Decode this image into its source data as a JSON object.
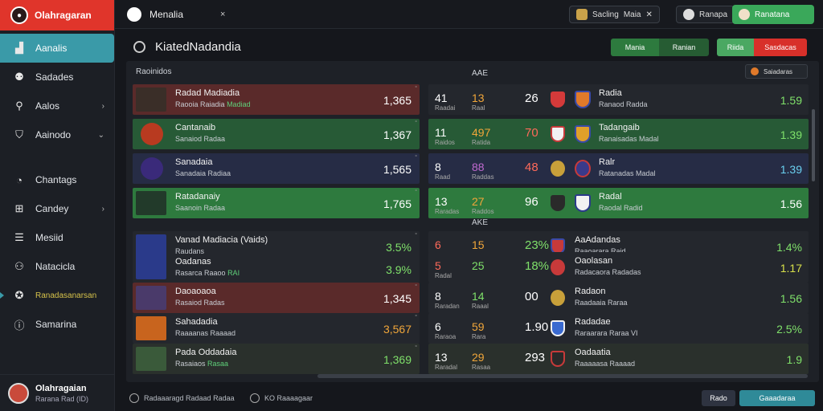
{
  "brand": {
    "name": "Olahragaran"
  },
  "sidebar": {
    "items": [
      {
        "label": "Aanalis",
        "icon": "chart-icon"
      },
      {
        "label": "Sadades",
        "icon": "users-icon"
      },
      {
        "label": "Aalos",
        "icon": "person-icon"
      },
      {
        "label": "Aainodo",
        "icon": "shield-icon"
      },
      {
        "label": "Chantags",
        "icon": "clock-icon"
      },
      {
        "label": "Candey",
        "icon": "plus-icon"
      },
      {
        "label": "Mesiid",
        "icon": "table-icon"
      },
      {
        "label": "Natacicla",
        "icon": "people-icon"
      },
      {
        "label": "Ranadasanarsan",
        "icon": "trophy-icon"
      },
      {
        "label": "Samarina",
        "icon": "info-icon"
      }
    ],
    "profile": {
      "name": "Olahragaian",
      "sub": "Rarana Rad (ID)"
    }
  },
  "topbar": {
    "tab_label": "Menalia",
    "tab_close": "×",
    "ctrl1": "Sacling",
    "ctrl2": "Maia",
    "ctrl3": "Ranapa",
    "user_btn": "Ranatana"
  },
  "header": {
    "title": "KiatedNadandia",
    "seg1": [
      "Mania",
      "Ranian"
    ],
    "seg2": [
      "Riida",
      "Sasdacas"
    ]
  },
  "panel": {
    "left_label": "Raoinidos",
    "mid_label_top": "AAE",
    "mid_label_bottom": "AKE",
    "filter": "Saiadaras"
  },
  "left_rows": [
    {
      "name": "Radad Madiadia",
      "sub_a": "Raooia Raiadia",
      "sub_b": "Madiad",
      "value": "1,365",
      "mini": "°"
    },
    {
      "name": "Cantanaib",
      "sub_a": "Sanaiod Radaa",
      "sub_b": "",
      "value": "1,367",
      "mini": "°"
    },
    {
      "name": "Sanadaia",
      "sub_a": "Sanadaia Radiaa",
      "sub_b": "",
      "value": "1,565",
      "mini": "°"
    },
    {
      "name": "Ratadanaiy",
      "sub_a": "Saanoin Radaa",
      "sub_b": "",
      "value": "1,765",
      "mini": "°"
    },
    {
      "name": "Vanad Madiacia (Vaids)",
      "sub_a": "Raudans",
      "sub_b": "",
      "value": "3.5%",
      "mini": "°"
    },
    {
      "name": "Oadanas",
      "sub_a": "Rasarca Raaoo",
      "sub_b": "RAI",
      "value": "3.9%",
      "mini": ""
    },
    {
      "name": "Daoaoaoa",
      "sub_a": "Rasaiod Radas",
      "sub_b": "",
      "value": "1,345",
      "mini": "°"
    },
    {
      "name": "Sahadadia",
      "sub_a": "Raaaanas Raaaad",
      "sub_b": "",
      "value": "3,567",
      "mini": "°"
    },
    {
      "name": "Pada Oddadaia",
      "sub_a": "Rasaiaos",
      "sub_b": "Rasaa",
      "value": "1,369",
      "mini": "°"
    }
  ],
  "right_rows": [
    {
      "a": "41",
      "b": "13",
      "c": "26",
      "x1": "Raadai",
      "x2": "Raal",
      "team": "Radia",
      "sub": "Ranaod Radda",
      "value": "1.59"
    },
    {
      "a": "11",
      "b": "497",
      "c": "70",
      "x1": "Raidos",
      "x2": "Ratida",
      "team": "Tadangaib",
      "sub": "Ranaisadas Madal",
      "value": "1.39"
    },
    {
      "a": "8",
      "b": "88",
      "c": "48",
      "x1": "Raad",
      "x2": "Raddas",
      "team": "Ralr",
      "sub": "Ratanadas Madal",
      "value": "1.39"
    },
    {
      "a": "13",
      "b": "27",
      "c": "96",
      "x1": "Raradas",
      "x2": "Raddos",
      "team": "Radal",
      "sub": "Raodal Radid",
      "value": "1.56"
    },
    {
      "a": "6",
      "b": "15",
      "c": "23%",
      "x1": "",
      "x2": "",
      "team": "AaAdandas",
      "sub": "Raaoarara Raid",
      "value": "1.4%"
    },
    {
      "a": "5",
      "b": "25",
      "c": "18%",
      "x1": "Radal",
      "x2": "",
      "team": "Oaolasan",
      "sub": "Radacaora Radadas",
      "value": "1.17"
    },
    {
      "a": "8",
      "b": "14",
      "c": "00",
      "x1": "Raradan",
      "x2": "Raaal",
      "team": "Radaon",
      "sub": "Raadaaia Raraa",
      "value": "1.56"
    },
    {
      "a": "6",
      "b": "59",
      "c": "1.90",
      "x1": "Raraoa",
      "x2": "Rara",
      "team": "Radadae",
      "sub": "Raraarara Raraa VI",
      "value": "2.5%"
    },
    {
      "a": "13",
      "b": "29",
      "c": "293",
      "x1": "Raradal",
      "x2": "Rasaa",
      "team": "Oadaatia",
      "sub": "Raaaaasa Raaaad",
      "value": "1.9"
    }
  ],
  "footer": {
    "left": "Radaaaragd Radaad Radaa",
    "mid": "KO Raaaagaar",
    "btn1": "Rado",
    "btn2": "Gaaadaraa"
  },
  "colors": {
    "accent_red": "#e0352b",
    "accent_teal": "#3a9aa8",
    "accent_green": "#3aa85a"
  }
}
